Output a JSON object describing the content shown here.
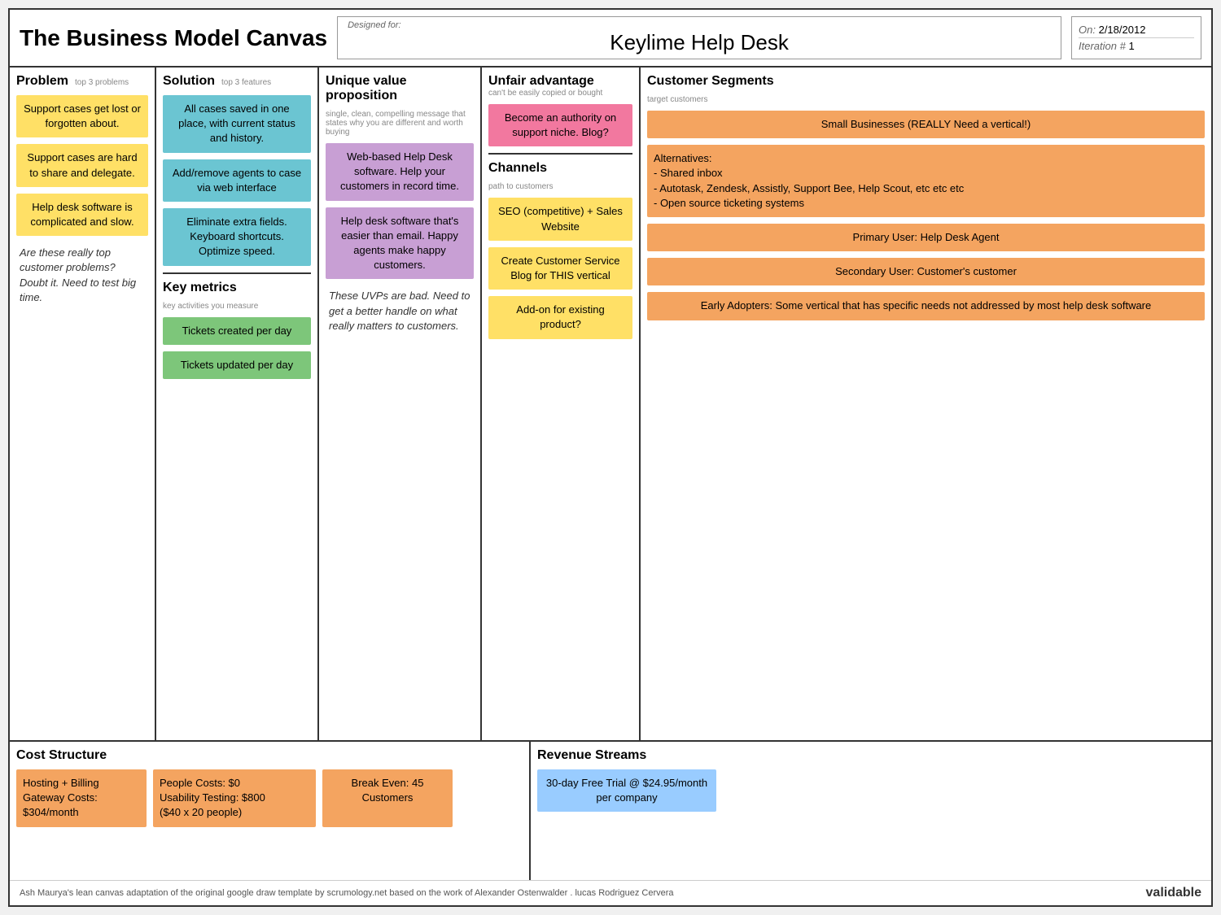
{
  "header": {
    "title": "The Business Model Canvas",
    "designed_for_label": "Designed for:",
    "canvas_name": "Keylime Help Desk",
    "on_label": "On:",
    "on_date": "2/18/2012",
    "iteration_label": "Iteration #",
    "iteration_number": "1"
  },
  "columns": {
    "problem": {
      "title": "Problem",
      "subtitle": "top 3 problems",
      "notes": [
        "Support cases get lost or forgotten about.",
        "Support cases are hard to share and delegate.",
        "Help desk software is complicated and slow."
      ],
      "italic_note": "Are these really top customer problems? Doubt it. Need to test big time."
    },
    "solution": {
      "title": "Solution",
      "subtitle": "top 3 features",
      "notes": [
        "All cases saved in one place, with current status and history.",
        "Add/remove agents to case via web interface",
        "Eliminate extra fields. Keyboard shortcuts. Optimize speed."
      ],
      "key_metrics": {
        "title": "Key metrics",
        "subtitle": "key activities you measure",
        "notes": [
          "Tickets created per day",
          "Tickets updated per day"
        ]
      }
    },
    "uvp": {
      "title": "Unique value proposition",
      "subtitle": "single, clean, compelling message that states why you are different and worth buying",
      "notes": [
        "Web-based Help Desk software. Help your customers in record time.",
        "Help desk software that's easier than email. Happy agents make happy customers."
      ],
      "italic_note": "These UVPs are bad. Need to get a better handle on what really matters to customers."
    },
    "unfair": {
      "title": "Unfair advantage",
      "subtitle": "can't be easily copied or bought",
      "notes": [
        "Become an authority on support niche. Blog?"
      ],
      "channels": {
        "title": "Channels",
        "subtitle": "path to customers",
        "notes": [
          "SEO (competitive) + Sales Website",
          "Create Customer Service Blog for THIS vertical",
          "Add-on for existing product?"
        ]
      }
    },
    "segments": {
      "title": "Customer Segments",
      "subtitle": "target customers",
      "notes": [
        "Small Businesses (REALLY Need a vertical!)",
        "Alternatives:\n- Shared inbox\n- Autotask, Zendesk, Assistly, Support Bee, Help Scout, etc etc etc\n- Open source ticketing systems",
        "Primary User: Help Desk Agent",
        "Secondary User: Customer's customer",
        "Early Adopters: Some vertical that has specific needs not addressed by most help desk software"
      ]
    }
  },
  "bottom": {
    "cost": {
      "title": "Cost Structure",
      "notes": [
        "Hosting + Billing Gateway Costs: $304/month",
        "People Costs: $0\nUsability Testing: $800\n($40 x 20 people)",
        "Break Even: 45 Customers"
      ]
    },
    "revenue": {
      "title": "Revenue Streams",
      "notes": [
        "30-day Free Trial @ $24.95/month per company"
      ]
    }
  },
  "footer": {
    "credit": "Ash Maurya's lean canvas adaptation of the original google draw template by scrumology.net based on the work of Alexander Ostenwalder . lucas Rodriguez Cervera",
    "logo": "validable"
  }
}
